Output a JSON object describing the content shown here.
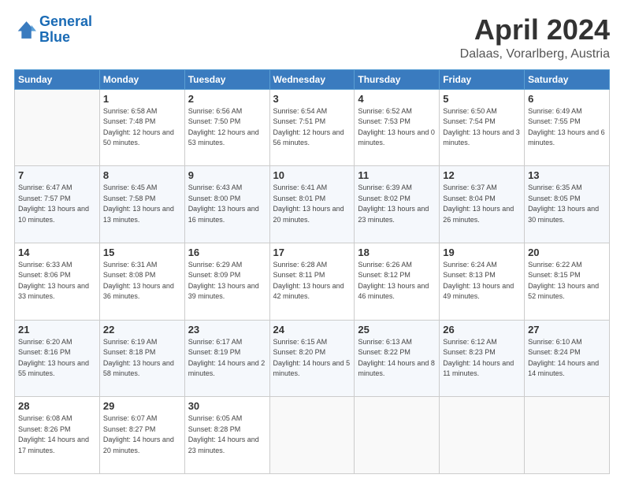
{
  "header": {
    "logo_line1": "General",
    "logo_line2": "Blue",
    "month": "April 2024",
    "location": "Dalaas, Vorarlberg, Austria"
  },
  "weekdays": [
    "Sunday",
    "Monday",
    "Tuesday",
    "Wednesday",
    "Thursday",
    "Friday",
    "Saturday"
  ],
  "weeks": [
    [
      {
        "day": "",
        "sunrise": "",
        "sunset": "",
        "daylight": ""
      },
      {
        "day": "1",
        "sunrise": "6:58 AM",
        "sunset": "7:48 PM",
        "daylight": "12 hours and 50 minutes."
      },
      {
        "day": "2",
        "sunrise": "6:56 AM",
        "sunset": "7:50 PM",
        "daylight": "12 hours and 53 minutes."
      },
      {
        "day": "3",
        "sunrise": "6:54 AM",
        "sunset": "7:51 PM",
        "daylight": "12 hours and 56 minutes."
      },
      {
        "day": "4",
        "sunrise": "6:52 AM",
        "sunset": "7:53 PM",
        "daylight": "13 hours and 0 minutes."
      },
      {
        "day": "5",
        "sunrise": "6:50 AM",
        "sunset": "7:54 PM",
        "daylight": "13 hours and 3 minutes."
      },
      {
        "day": "6",
        "sunrise": "6:49 AM",
        "sunset": "7:55 PM",
        "daylight": "13 hours and 6 minutes."
      }
    ],
    [
      {
        "day": "7",
        "sunrise": "6:47 AM",
        "sunset": "7:57 PM",
        "daylight": "13 hours and 10 minutes."
      },
      {
        "day": "8",
        "sunrise": "6:45 AM",
        "sunset": "7:58 PM",
        "daylight": "13 hours and 13 minutes."
      },
      {
        "day": "9",
        "sunrise": "6:43 AM",
        "sunset": "8:00 PM",
        "daylight": "13 hours and 16 minutes."
      },
      {
        "day": "10",
        "sunrise": "6:41 AM",
        "sunset": "8:01 PM",
        "daylight": "13 hours and 20 minutes."
      },
      {
        "day": "11",
        "sunrise": "6:39 AM",
        "sunset": "8:02 PM",
        "daylight": "13 hours and 23 minutes."
      },
      {
        "day": "12",
        "sunrise": "6:37 AM",
        "sunset": "8:04 PM",
        "daylight": "13 hours and 26 minutes."
      },
      {
        "day": "13",
        "sunrise": "6:35 AM",
        "sunset": "8:05 PM",
        "daylight": "13 hours and 30 minutes."
      }
    ],
    [
      {
        "day": "14",
        "sunrise": "6:33 AM",
        "sunset": "8:06 PM",
        "daylight": "13 hours and 33 minutes."
      },
      {
        "day": "15",
        "sunrise": "6:31 AM",
        "sunset": "8:08 PM",
        "daylight": "13 hours and 36 minutes."
      },
      {
        "day": "16",
        "sunrise": "6:29 AM",
        "sunset": "8:09 PM",
        "daylight": "13 hours and 39 minutes."
      },
      {
        "day": "17",
        "sunrise": "6:28 AM",
        "sunset": "8:11 PM",
        "daylight": "13 hours and 42 minutes."
      },
      {
        "day": "18",
        "sunrise": "6:26 AM",
        "sunset": "8:12 PM",
        "daylight": "13 hours and 46 minutes."
      },
      {
        "day": "19",
        "sunrise": "6:24 AM",
        "sunset": "8:13 PM",
        "daylight": "13 hours and 49 minutes."
      },
      {
        "day": "20",
        "sunrise": "6:22 AM",
        "sunset": "8:15 PM",
        "daylight": "13 hours and 52 minutes."
      }
    ],
    [
      {
        "day": "21",
        "sunrise": "6:20 AM",
        "sunset": "8:16 PM",
        "daylight": "13 hours and 55 minutes."
      },
      {
        "day": "22",
        "sunrise": "6:19 AM",
        "sunset": "8:18 PM",
        "daylight": "13 hours and 58 minutes."
      },
      {
        "day": "23",
        "sunrise": "6:17 AM",
        "sunset": "8:19 PM",
        "daylight": "14 hours and 2 minutes."
      },
      {
        "day": "24",
        "sunrise": "6:15 AM",
        "sunset": "8:20 PM",
        "daylight": "14 hours and 5 minutes."
      },
      {
        "day": "25",
        "sunrise": "6:13 AM",
        "sunset": "8:22 PM",
        "daylight": "14 hours and 8 minutes."
      },
      {
        "day": "26",
        "sunrise": "6:12 AM",
        "sunset": "8:23 PM",
        "daylight": "14 hours and 11 minutes."
      },
      {
        "day": "27",
        "sunrise": "6:10 AM",
        "sunset": "8:24 PM",
        "daylight": "14 hours and 14 minutes."
      }
    ],
    [
      {
        "day": "28",
        "sunrise": "6:08 AM",
        "sunset": "8:26 PM",
        "daylight": "14 hours and 17 minutes."
      },
      {
        "day": "29",
        "sunrise": "6:07 AM",
        "sunset": "8:27 PM",
        "daylight": "14 hours and 20 minutes."
      },
      {
        "day": "30",
        "sunrise": "6:05 AM",
        "sunset": "8:28 PM",
        "daylight": "14 hours and 23 minutes."
      },
      {
        "day": "",
        "sunrise": "",
        "sunset": "",
        "daylight": ""
      },
      {
        "day": "",
        "sunrise": "",
        "sunset": "",
        "daylight": ""
      },
      {
        "day": "",
        "sunrise": "",
        "sunset": "",
        "daylight": ""
      },
      {
        "day": "",
        "sunrise": "",
        "sunset": "",
        "daylight": ""
      }
    ]
  ]
}
